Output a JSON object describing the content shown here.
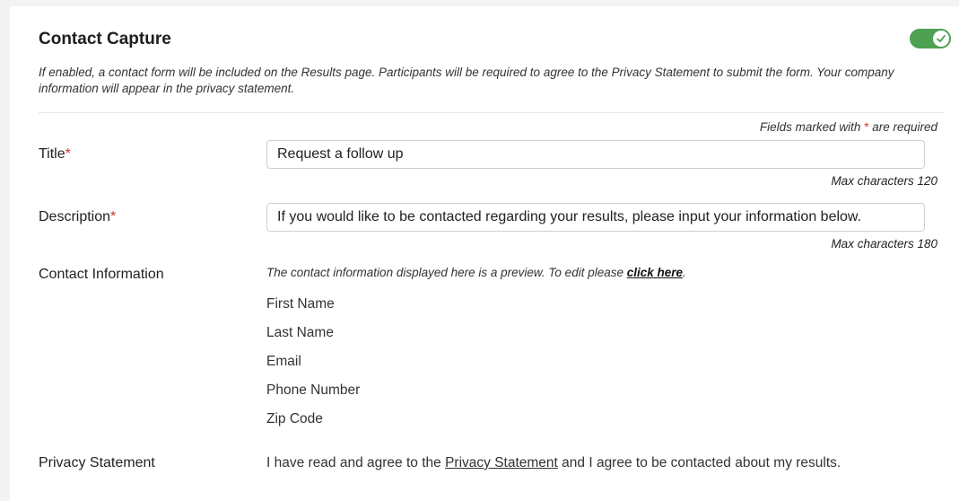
{
  "section": {
    "title": "Contact Capture",
    "enabled": true,
    "accent_color": "#4ea152",
    "description": "If enabled, a contact form will be included on the Results page. Participants will be required to agree to the Privacy Statement to submit the form. Your company information will appear in the privacy statement."
  },
  "required_note": {
    "prefix": "Fields marked with ",
    "star": "*",
    "suffix": " are required"
  },
  "title_field": {
    "label": "Title",
    "required_star": "*",
    "value": "Request a follow up",
    "max_note": "Max characters 120"
  },
  "description_field": {
    "label": "Description",
    "required_star": "*",
    "value": "If you would like to be contacted regarding your results, please input your information below.",
    "max_note": "Max characters 180"
  },
  "contact_info": {
    "label": "Contact Information",
    "preview_text": "The contact information displayed here is a preview. To edit please ",
    "link_text": "click here",
    "preview_end": ".",
    "fields": [
      "First Name",
      "Last Name",
      "Email",
      "Phone Number",
      "Zip Code"
    ]
  },
  "privacy": {
    "label": "Privacy Statement",
    "text_before": "I have read and agree to the ",
    "link_text": "Privacy Statement",
    "text_after": " and I agree to be contacted about my results."
  }
}
